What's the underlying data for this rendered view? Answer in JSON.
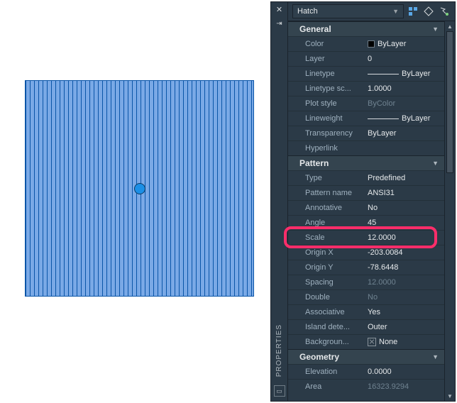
{
  "panel": {
    "title": "PROPERTIES",
    "object_type": "Hatch"
  },
  "groups": [
    {
      "name": "General",
      "rows": [
        {
          "label": "Color",
          "value": "ByLayer",
          "swatch": true
        },
        {
          "label": "Layer",
          "value": "0"
        },
        {
          "label": "Linetype",
          "value": "ByLayer",
          "line": true
        },
        {
          "label": "Linetype sc...",
          "value": "1.0000"
        },
        {
          "label": "Plot style",
          "value": "ByColor",
          "dim": true
        },
        {
          "label": "Lineweight",
          "value": "ByLayer",
          "line": true
        },
        {
          "label": "Transparency",
          "value": "ByLayer"
        },
        {
          "label": "Hyperlink",
          "value": ""
        }
      ]
    },
    {
      "name": "Pattern",
      "rows": [
        {
          "label": "Type",
          "value": "Predefined"
        },
        {
          "label": "Pattern name",
          "value": "ANSI31"
        },
        {
          "label": "Annotative",
          "value": "No"
        },
        {
          "label": "Angle",
          "value": "45"
        },
        {
          "label": "Scale",
          "value": "12.0000",
          "highlight": true
        },
        {
          "label": "Origin X",
          "value": "-203.0084"
        },
        {
          "label": "Origin Y",
          "value": "-78.6448"
        },
        {
          "label": "Spacing",
          "value": "12.0000",
          "dim": true
        },
        {
          "label": "Double",
          "value": "No",
          "dim": true
        },
        {
          "label": "Associative",
          "value": "Yes"
        },
        {
          "label": "Island dete...",
          "value": "Outer"
        },
        {
          "label": "Backgroun...",
          "value": "None",
          "check": true
        }
      ]
    },
    {
      "name": "Geometry",
      "rows": [
        {
          "label": "Elevation",
          "value": "0.0000"
        },
        {
          "label": "Area",
          "value": "16323.9294",
          "dim": true
        }
      ]
    }
  ]
}
